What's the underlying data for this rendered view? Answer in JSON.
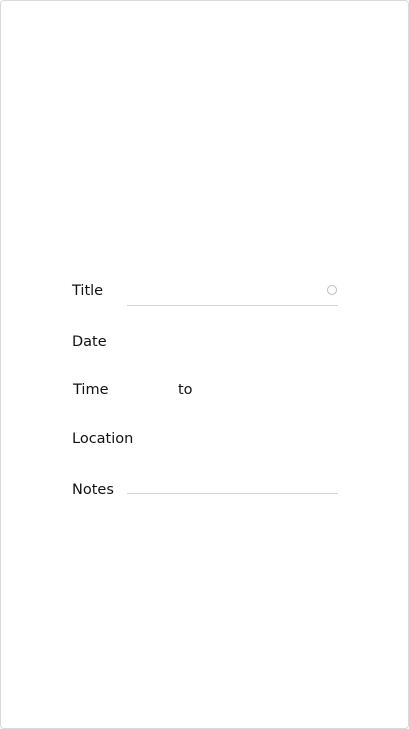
{
  "form": {
    "title": {
      "label": "Title",
      "value": "",
      "clear_icon": "circle-clear-icon"
    },
    "date": {
      "label": "Date",
      "value": ""
    },
    "time": {
      "label": "Time",
      "separator": "to",
      "start": "",
      "end": ""
    },
    "location": {
      "label": "Location",
      "value": ""
    },
    "notes": {
      "label": "Notes",
      "value": ""
    }
  }
}
